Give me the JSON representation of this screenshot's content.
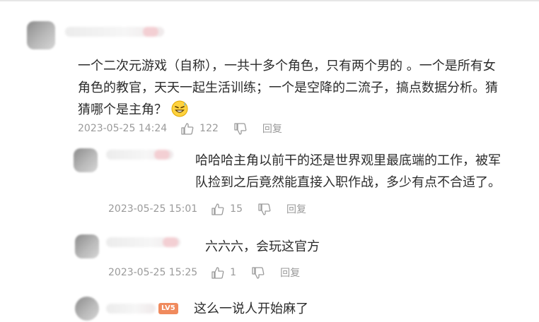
{
  "comments": [
    {
      "text_lines": [
        "一个二次元游戏（自称），一共十多个角色，只有两个男的 。一个是所有女",
        "角色的教官，天天一起生活训练；一个是空降的二流子，搞点数据分析。猜",
        "猜哪个是主角？"
      ],
      "emoji": "sweat-grin-emoji",
      "date": "2023-05-25 14:24",
      "likes": "122",
      "reply_label": "回复"
    },
    {
      "text_lines": [
        "哈哈哈主角以前干的还是世界观里最底端的工作，被军",
        "队捡到之后竟然能直接入职作战，多少有点不合适了。"
      ],
      "date": "2023-05-25 15:01",
      "likes": "15",
      "reply_label": "回复"
    },
    {
      "text_lines": [
        "六六六，会玩这官方"
      ],
      "date": "2023-05-25 15:25",
      "likes": "1",
      "reply_label": "回复"
    },
    {
      "text_lines": [
        "这么一说人开始麻了"
      ],
      "level_badge": "LV5"
    }
  ],
  "colors": {
    "text": "#2b2b2b",
    "meta": "#9a9a9a",
    "badge": "#f08a5d"
  }
}
